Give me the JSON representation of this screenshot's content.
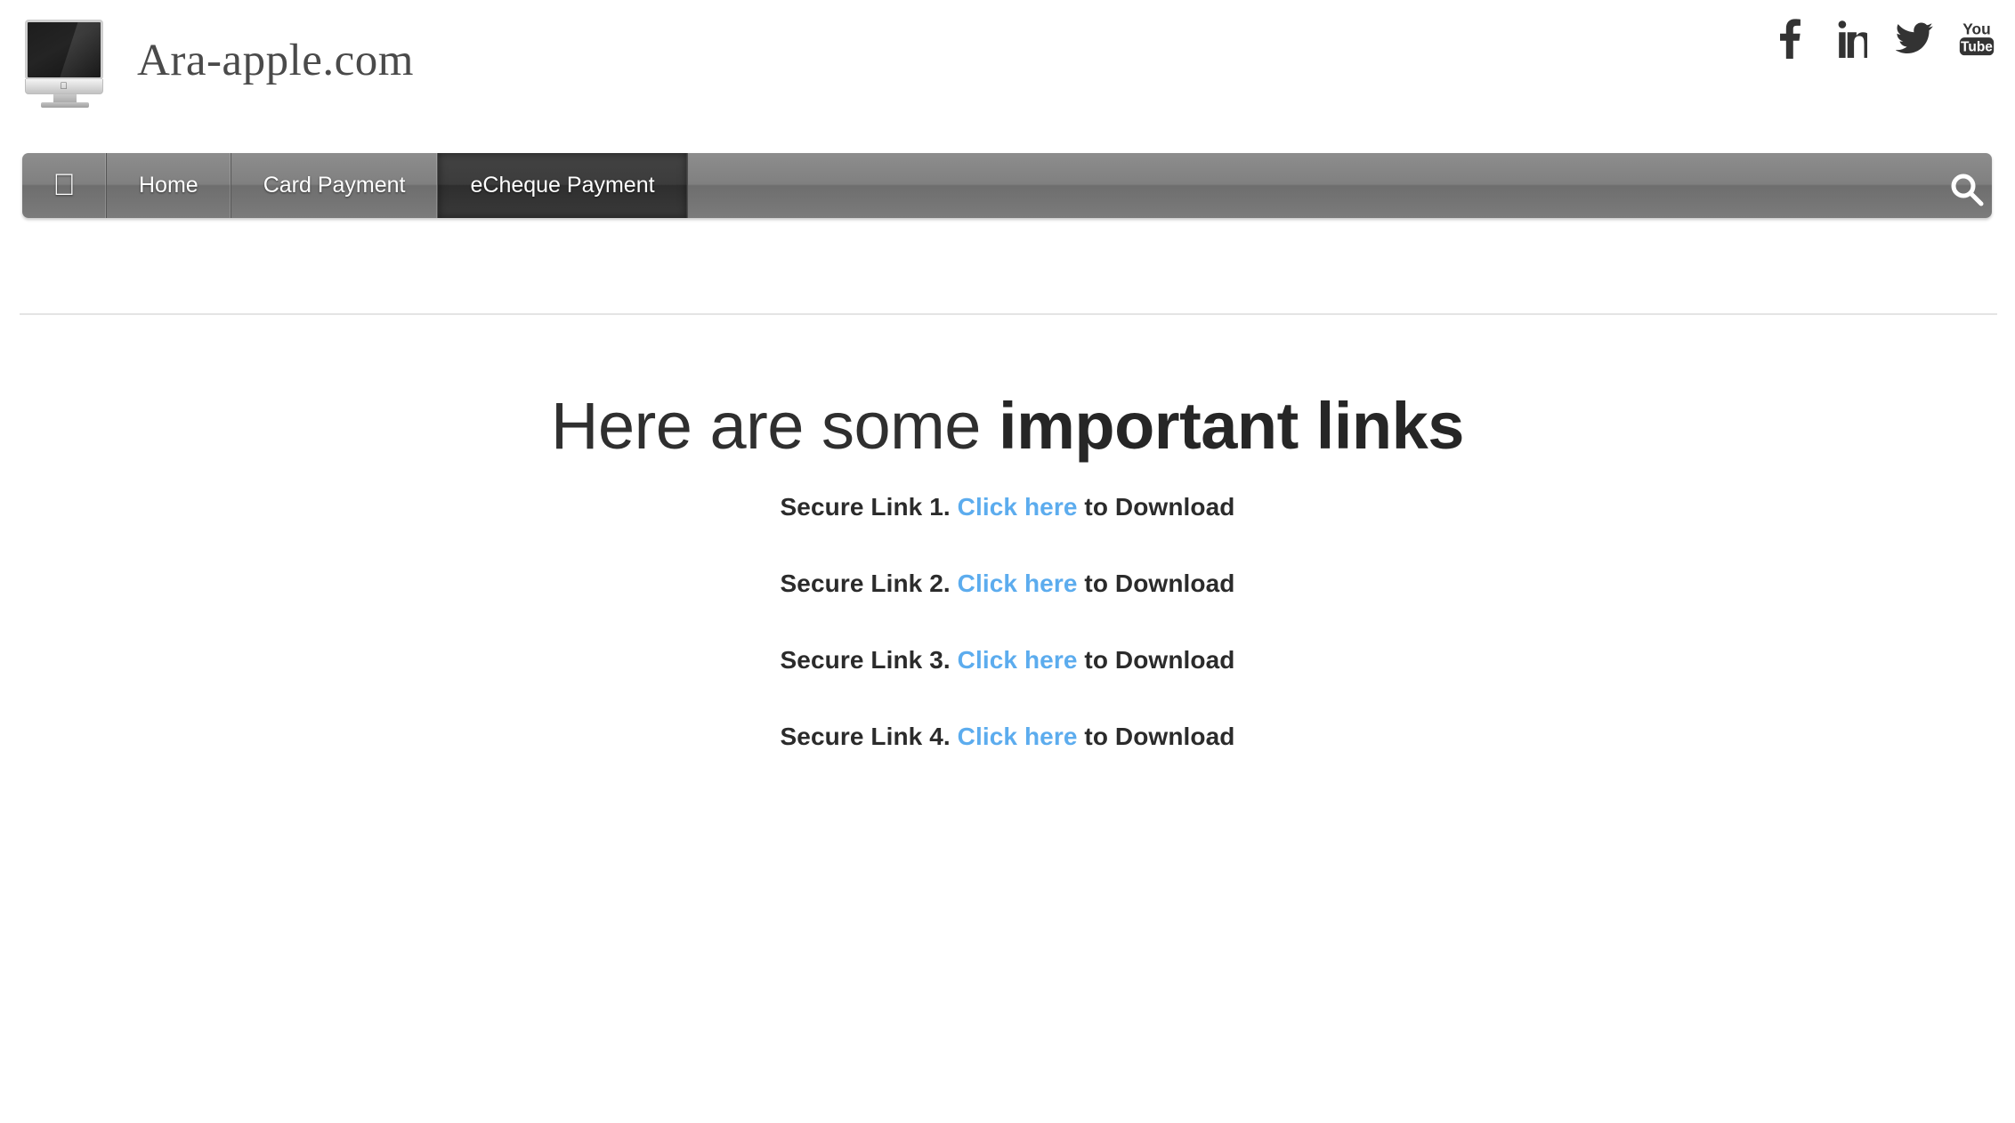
{
  "header": {
    "brand_name": "Ara-apple.com",
    "logo_icon": "imac-computer-icon",
    "social_links": [
      {
        "name": "facebook",
        "label": "Facebook"
      },
      {
        "name": "linkedin",
        "label": "LinkedIn"
      },
      {
        "name": "twitter",
        "label": "Twitter"
      },
      {
        "name": "youtube",
        "label": "YouTube"
      }
    ]
  },
  "nav": {
    "home_icon": "apple-logo-icon",
    "items": [
      {
        "label": "Home",
        "active": false
      },
      {
        "label": "Card Payment",
        "active": false
      },
      {
        "label": "eCheque Payment",
        "active": true
      }
    ],
    "search_icon": "search-icon"
  },
  "main": {
    "title_light": "Here are some ",
    "title_bold": "important links",
    "links": [
      {
        "prefix": "Secure Link 1.",
        "anchor": "Click here",
        "suffix": "to Download"
      },
      {
        "prefix": "Secure Link 2.",
        "anchor": "Click here",
        "suffix": "to Download"
      },
      {
        "prefix": "Secure Link 3.",
        "anchor": "Click here",
        "suffix": "to Download"
      },
      {
        "prefix": "Secure Link 4.",
        "anchor": "Click here",
        "suffix": "to Download"
      }
    ]
  },
  "colors": {
    "link_blue": "#5CACEE",
    "nav_gray": "#808080",
    "nav_active_gray": "#3a3a3a",
    "text_dark": "#2b2b2b",
    "divider": "#e4e4e4"
  }
}
